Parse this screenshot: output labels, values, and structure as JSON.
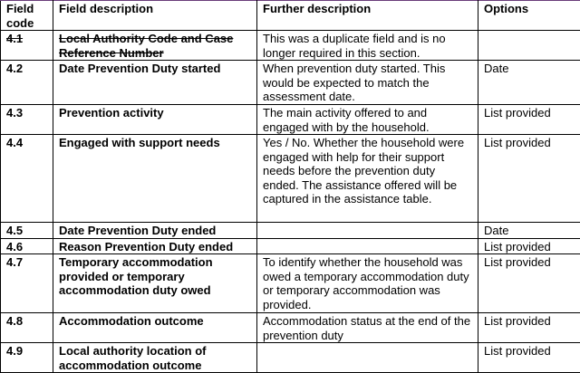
{
  "table": {
    "headers": {
      "code": "Field code",
      "description": "Field description",
      "further": "Further description",
      "options": "Options"
    },
    "rows": [
      {
        "code": "4.1",
        "field": "Local Authority Code and Case Reference Number",
        "further": "This was a duplicate field and is no longer required in this section.",
        "options": "",
        "struck": true
      },
      {
        "code": "4.2",
        "field": "Date Prevention Duty started",
        "further": "When prevention duty started. This would be expected to match the assessment date.",
        "options": "Date"
      },
      {
        "code": "4.3",
        "field": "Prevention activity",
        "further": "The main activity offered to and engaged with by the household.",
        "options": "List provided"
      },
      {
        "code": "4.4",
        "field": "Engaged with support needs",
        "further": "Yes / No. Whether the household were engaged with help for their support needs before the prevention duty ended. The assistance offered will be captured in the assistance table.",
        "options": "List provided"
      },
      {
        "code": "4.5",
        "field": "Date Prevention Duty ended",
        "further": "",
        "options": "Date"
      },
      {
        "code": "4.6",
        "field": "Reason Prevention Duty ended",
        "further": "",
        "options": "List provided"
      },
      {
        "code": "4.7",
        "field": "Temporary accommodation provided or temporary accommodation duty owed",
        "further": "To identify whether the household was owed a temporary accommodation duty or temporary accommodation was provided.",
        "options": "List provided"
      },
      {
        "code": "4.8",
        "field": "Accommodation outcome",
        "further": "Accommodation status at the end of the prevention duty",
        "options": "List provided"
      },
      {
        "code": "4.9",
        "field": "Local authority location of accommodation outcome",
        "further": "",
        "options": "List provided"
      }
    ]
  }
}
